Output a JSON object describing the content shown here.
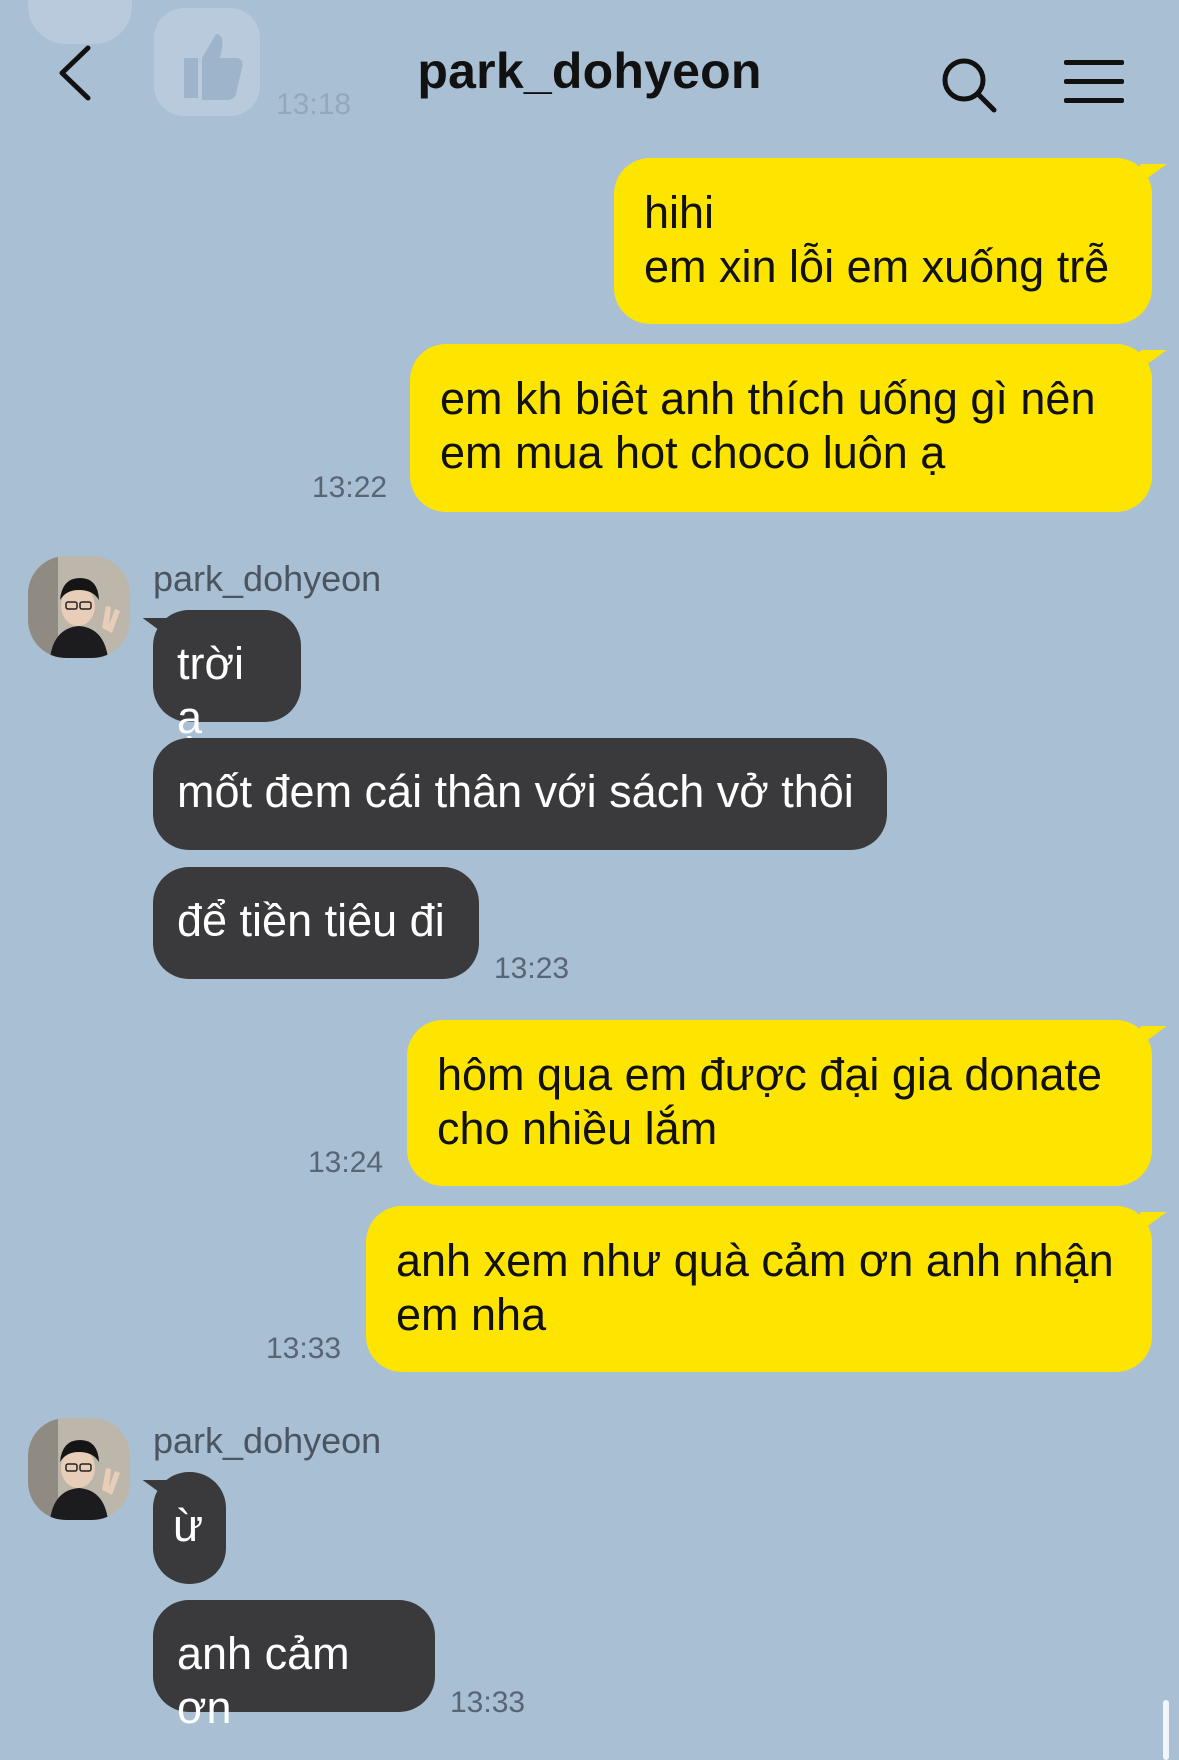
{
  "header": {
    "title": "park_dohyeon",
    "back_icon": "chevron-left-icon",
    "search_icon": "search-icon",
    "menu_icon": "hamburger-menu-icon"
  },
  "faded_top": {
    "timestamp": "13:18",
    "sticker_icon": "thumbs-up-icon"
  },
  "colors": {
    "background": "#a9bfd3",
    "my_bubble": "#fee500",
    "their_bubble": "#3a3a3c"
  },
  "messages": [
    {
      "from": "me",
      "text": "hihi\nem xin lỗi em xuống trễ"
    },
    {
      "from": "me",
      "text": "em kh biêt anh thích uống gì nên\nem mua hot choco luôn ạ",
      "time": "13:22"
    },
    {
      "from": "them",
      "sender": "park_dohyeon",
      "text": "trời ạ"
    },
    {
      "from": "them",
      "text": "mốt đem cái thân với sách vở thôi"
    },
    {
      "from": "them",
      "text": "để tiền tiêu đi",
      "time": "13:23"
    },
    {
      "from": "me",
      "text": "hôm qua em được đại gia donate\ncho nhiều lắm",
      "time": "13:24"
    },
    {
      "from": "me",
      "text": "anh xem như quà cảm ơn anh nhận\nem nha",
      "time": "13:33"
    },
    {
      "from": "them",
      "sender": "park_dohyeon",
      "text": "ừ"
    },
    {
      "from": "them",
      "text": "anh cảm ơn",
      "time": "13:33"
    }
  ]
}
